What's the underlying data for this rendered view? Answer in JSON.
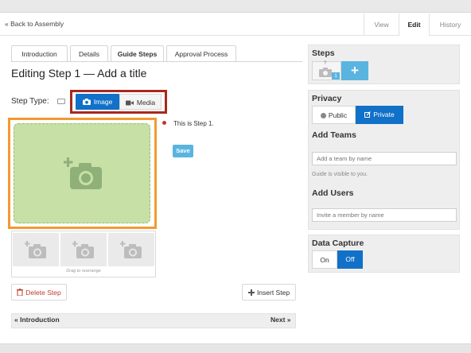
{
  "header": {
    "back_label": "« Back to Assembly",
    "tabs": [
      {
        "label": "View"
      },
      {
        "label": "Edit"
      },
      {
        "label": "History"
      }
    ]
  },
  "guide_tabs": [
    {
      "label": "Introduction"
    },
    {
      "label": "Details"
    },
    {
      "label": "Guide Steps"
    },
    {
      "label": "Approval Process"
    }
  ],
  "editor": {
    "title": "Editing Step 1 — Add a title",
    "step_type_label": "Step Type:",
    "image_button": "Image",
    "media_button": "Media",
    "drag_hint": "Drag to rearrange",
    "bullet_text": "This is Step 1.",
    "save_button": "Save",
    "delete_button": "Delete Step",
    "insert_button": "Insert Step",
    "prev_link": "« Introduction",
    "next_link": "Next »"
  },
  "sidebar": {
    "steps_title": "Steps",
    "step_badge": "1",
    "step_thumb_mark": "?",
    "add_step_symbol": "+",
    "privacy_title": "Privacy",
    "public_label": "Public",
    "private_label": "Private",
    "add_teams_title": "Add Teams",
    "team_placeholder": "Add a team by name",
    "visibility_note": "Guide is visible to you.",
    "add_users_title": "Add Users",
    "user_placeholder": "Invite a member by name",
    "data_capture_title": "Data Capture",
    "on_label": "On",
    "off_label": "Off"
  },
  "colors": {
    "primary_blue": "#1170c8",
    "step_add_blue": "#5ab4e0",
    "highlight_red": "#a8281f",
    "highlight_orange": "#f29a31",
    "image_green": "#c6e0a6"
  }
}
